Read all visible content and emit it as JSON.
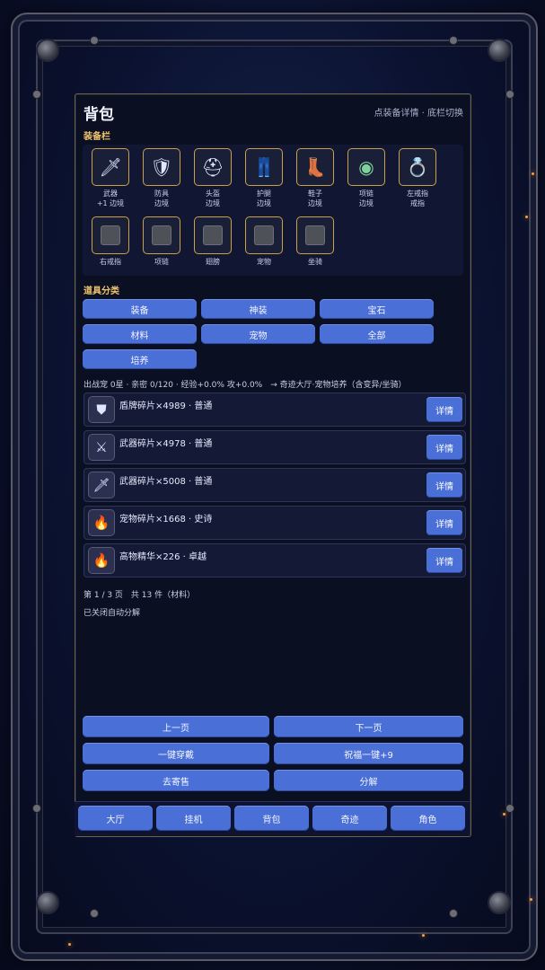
{
  "header": {
    "title": "背包",
    "hint": "点装备详情 · 底栏切换"
  },
  "equipment": {
    "section_label": "装备栏",
    "slots": [
      {
        "name": "武器",
        "sub": "+1 边境",
        "icon": "sword-icon",
        "glyph": "🗡"
      },
      {
        "name": "防具",
        "sub": "边境",
        "icon": "armor-icon",
        "glyph": "🛡"
      },
      {
        "name": "头盔",
        "sub": "边境",
        "icon": "helmet-icon",
        "glyph": "⛑"
      },
      {
        "name": "护腿",
        "sub": "边境",
        "icon": "leggings-icon",
        "glyph": "👖"
      },
      {
        "name": "鞋子",
        "sub": "边境",
        "icon": "boots-icon",
        "glyph": "👢"
      },
      {
        "name": "项链",
        "sub": "边境",
        "icon": "necklace-icon",
        "glyph": "◉"
      },
      {
        "name": "左戒指",
        "sub": "戒指",
        "icon": "ring-icon",
        "glyph": "💍"
      },
      {
        "name": "右戒指",
        "sub": "",
        "icon": "empty-slot-icon",
        "glyph": ""
      },
      {
        "name": "项链",
        "sub": "",
        "icon": "empty-slot-icon",
        "glyph": ""
      },
      {
        "name": "翅膀",
        "sub": "",
        "icon": "empty-slot-icon",
        "glyph": ""
      },
      {
        "name": "宠物",
        "sub": "",
        "icon": "empty-slot-icon",
        "glyph": ""
      },
      {
        "name": "坐骑",
        "sub": "",
        "icon": "empty-slot-icon",
        "glyph": ""
      }
    ]
  },
  "categories": {
    "section_label": "道具分类",
    "items": [
      "装备",
      "神装",
      "宝石",
      "材料",
      "宠物",
      "全部",
      "培养"
    ]
  },
  "status_line": "出战宠 0星 · 亲密 0/120 · 经验+0.0% 攻+0.0%　→ 奇迹大厅·宠物培养（含变异/坐骑）",
  "inventory": {
    "detail_label": "详情",
    "items": [
      {
        "text": "盾牌碎片×4989 · 普通",
        "icon": "shield-fragment-icon",
        "glyph": "⛊"
      },
      {
        "text": "武器碎片×4978 · 普通",
        "icon": "weapon-fragment-icon",
        "glyph": "⚔"
      },
      {
        "text": "武器碎片×5008 · 普通",
        "icon": "weapon-fragment-icon",
        "glyph": "🗡"
      },
      {
        "text": "宠物碎片×1668 · 史诗",
        "icon": "pet-fragment-icon",
        "glyph": "🔥"
      },
      {
        "text": "高物精华×226 · 卓越",
        "icon": "essence-icon",
        "glyph": "🔥"
      }
    ]
  },
  "pagination": {
    "info": "第 1 / 3 页　共 13 件（材料）",
    "auto_info": "已关闭自动分解"
  },
  "actions": {
    "prev": "上一页",
    "next": "下一页",
    "equip_all": "一键穿戴",
    "bless": "祝福一键+9",
    "consign": "去寄售",
    "decompose": "分解"
  },
  "nav": [
    "大厅",
    "挂机",
    "背包",
    "奇迹",
    "角色"
  ],
  "colors": {
    "button": "#4a6fd6",
    "accent": "#f1c36e",
    "panel": "#0a1022"
  }
}
